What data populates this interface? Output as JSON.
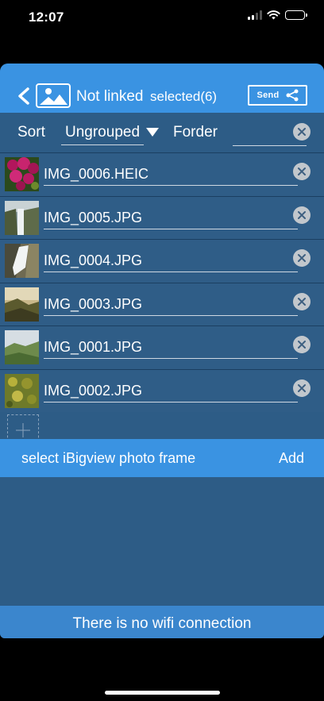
{
  "status_bar": {
    "time": "12:07"
  },
  "header": {
    "link_status": "Not linked",
    "selected": "selected(6)",
    "send_label": "Send"
  },
  "sort_bar": {
    "sort_label": "Sort",
    "grouping_value": "Ungrouped",
    "forder_label": "Forder",
    "forder_value": ""
  },
  "files": [
    {
      "name": "IMG_0006.HEIC"
    },
    {
      "name": "IMG_0005.JPG"
    },
    {
      "name": "IMG_0004.JPG"
    },
    {
      "name": "IMG_0003.JPG"
    },
    {
      "name": "IMG_0001.JPG"
    },
    {
      "name": "IMG_0002.JPG"
    }
  ],
  "frame_bar": {
    "label": "select iBigview photo frame",
    "add_label": "Add"
  },
  "footer": {
    "message": "There is no wifi connection"
  },
  "colors": {
    "header_blue": "#3a93e2",
    "panel_blue": "#2d5c86",
    "footer_blue": "#3b86cd",
    "clear_grey": "#c2c7cc"
  }
}
